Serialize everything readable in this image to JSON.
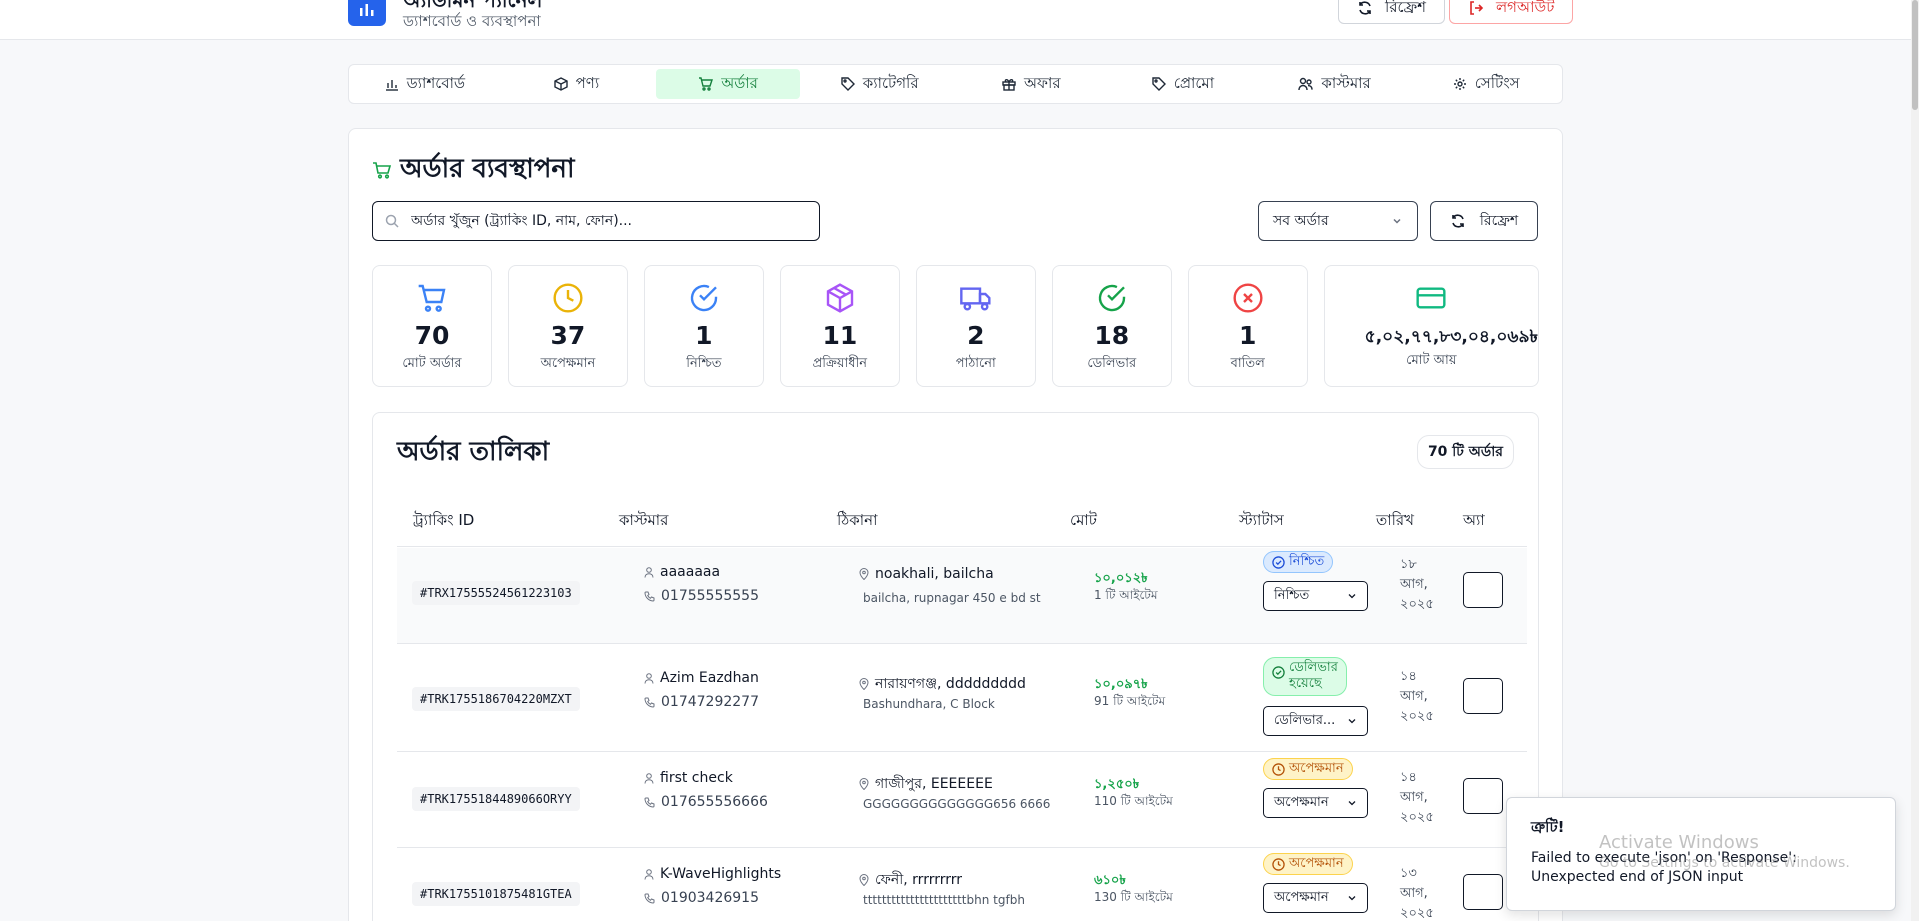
{
  "app": {
    "title": "অ্যাডমিন প্যানেল",
    "subtitle": "ড্যাশবোর্ড ও ব্যবস্থাপনা",
    "refresh_label": "রিফ্রেশ",
    "logout_label": "লগআউট"
  },
  "nav": [
    {
      "label": "ড্যাশবোর্ড",
      "icon": "bar-chart-icon"
    },
    {
      "label": "পণ্য",
      "icon": "box-icon"
    },
    {
      "label": "অর্ডার",
      "icon": "cart-icon",
      "active": true
    },
    {
      "label": "ক্যাটেগরি",
      "icon": "tag-icon"
    },
    {
      "label": "অফার",
      "icon": "gift-icon"
    },
    {
      "label": "প্রোমো",
      "icon": "tag-icon"
    },
    {
      "label": "কাস্টমার",
      "icon": "users-icon"
    },
    {
      "label": "সেটিংস",
      "icon": "gear-icon"
    }
  ],
  "page": {
    "title": "অর্ডার ব্যবস্থাপনা",
    "search_placeholder": "অর্ডার খুঁজুন (ট্র্যাকিং ID, নাম, ফোন)...",
    "filter_value": "সব অর্ডার",
    "refresh_label": "রিফ্রেশ"
  },
  "stats": [
    {
      "value": "70",
      "label": "মোট অর্ডার",
      "icon": "cart-icon",
      "color": "#3b82f6"
    },
    {
      "value": "37",
      "label": "অপেক্ষমান",
      "icon": "clock-icon",
      "color": "#eab308"
    },
    {
      "value": "1",
      "label": "নিশ্চিত",
      "icon": "check-circle-icon",
      "color": "#3b82f6"
    },
    {
      "value": "11",
      "label": "প্রক্রিয়াধীন",
      "icon": "package-icon",
      "color": "#a855f7"
    },
    {
      "value": "2",
      "label": "পাঠানো",
      "icon": "truck-icon",
      "color": "#6366f1"
    },
    {
      "value": "18",
      "label": "ডেলিভার",
      "icon": "check-circle-icon",
      "color": "#16a34a"
    },
    {
      "value": "1",
      "label": "বাতিল",
      "icon": "x-circle-icon",
      "color": "#ef4444"
    },
    {
      "value": "৫,০২,৭৭,৮৩,০৪,০৬৯৳",
      "label": "মোট আয়",
      "icon": "credit-card-icon",
      "color": "#10b981"
    }
  ],
  "table": {
    "title": "অর্ডার তালিকা",
    "count_label": "70 টি অর্ডার",
    "headers": [
      "ট্র্যাকিং ID",
      "কাস্টমার",
      "ঠিকানা",
      "মোট",
      "স্ট্যাটাস",
      "তারিখ",
      "অ্যা"
    ],
    "rows": [
      {
        "tracking_id": "#TRX17555524561223103",
        "customer_name": "aaaaaaa",
        "phone": "01755555555",
        "address": "noakhali, bailcha",
        "address_detail": "bailcha, rupnagar 450 e bd st",
        "amount": "১০,০১২৳",
        "items": "1 টি আইটেম",
        "status_badge_line1": "নিশ্চিত",
        "status_badge_line2": "",
        "status_select": "নিশ্চিত",
        "date_line1": "১৮",
        "date_line2": "আগ,",
        "date_line3": "২০২৫"
      },
      {
        "tracking_id": "#TRK1755186704220MZXT",
        "customer_name": "Azim Eazdhan",
        "phone": "01747292277",
        "address": "নারায়ণগঞ্জ, ddddddddd",
        "address_detail": "Bashundhara, C Block",
        "amount": "১০,০৯৭৳",
        "items": "91 টি আইটেম",
        "status_badge_line1": "ডেলিভার",
        "status_badge_line2": "হয়েছে",
        "status_select": "ডেলিভার...",
        "date_line1": "১৪",
        "date_line2": "আগ,",
        "date_line3": "২০২৫"
      },
      {
        "tracking_id": "#TRK1755184489066ORYY",
        "customer_name": "first check",
        "phone": "017655556666",
        "address": "গাজীপুর, EEEEEEE",
        "address_detail": "GGGGGGGGGGGGGG656 6666",
        "amount": "১,২৫০৳",
        "items": "110 টি আইটেম",
        "status_badge_line1": "অপেক্ষমান",
        "status_badge_line2": "",
        "status_select": "অপেক্ষমান",
        "date_line1": "১৪",
        "date_line2": "আগ,",
        "date_line3": "২০২৫"
      },
      {
        "tracking_id": "#TRK1755101875481GTEA",
        "customer_name": "K-WaveHighlights",
        "phone": "01903426915",
        "address": "ফেনী, rrrrrrrrr",
        "address_detail": "ttttttttttttttttttttttbhn tgfbh",
        "amount": "৬১০৳",
        "items": "130 টি আইটেম",
        "status_badge_line1": "অপেক্ষমান",
        "status_badge_line2": "",
        "status_select": "অপেক্ষমান",
        "date_line1": "১৩",
        "date_line2": "আগ,",
        "date_line3": "২০২৫"
      }
    ]
  },
  "toast": {
    "title": "ত্রুটি!",
    "message_line1": "Failed to execute 'json' on 'Response':",
    "message_line2": "Unexpected end of JSON input"
  },
  "watermark": {
    "line1": "Activate Windows",
    "line2": "Go to Settings to activate Windows."
  }
}
